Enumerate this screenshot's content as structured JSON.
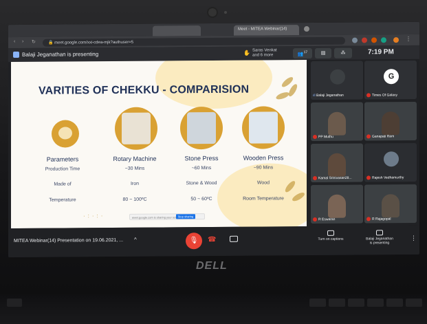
{
  "browser": {
    "tabs": [
      {
        "label": "",
        "active": false
      },
      {
        "label": "Meet - MITEA Webinar(14)",
        "active": true
      }
    ],
    "url": "meet.google.com/xxi-cdea-mjk?authuser=5"
  },
  "meet": {
    "presenting_text": "Balaji Jeganathan is presenting",
    "saras_line1": "Saras Venkat",
    "saras_line2": "and 6 more",
    "participant_count": "17",
    "clock": "7:19 PM"
  },
  "slide": {
    "title": "VARITIES OF CHEKKU - COMPARISION",
    "headers": [
      "Parameters",
      "Rotary Machine",
      "Stone Press",
      "Wooden Press"
    ],
    "rows": [
      {
        "label": "Production Time",
        "values": [
          "~30 Mins",
          "~60 Mins",
          "~90 Mins"
        ]
      },
      {
        "label": "Made of",
        "values": [
          "Iron",
          "Stone & Wood",
          "Wood"
        ]
      },
      {
        "label": "Temperature",
        "values": [
          "80 ~ 100ºC",
          "50 ~ 60ºC",
          "Room Temperature"
        ]
      }
    ],
    "share_bar_text": "meet.google.com is sharing your screen",
    "share_bar_button": "Stop sharing"
  },
  "participants": [
    {
      "name": "Balaji Jeganathan",
      "type": "speaking"
    },
    {
      "name": "Times Of Galaxy",
      "type": "logo",
      "initial": "G"
    },
    {
      "name": "PP Muthu",
      "type": "video"
    },
    {
      "name": "Ganapati Ram",
      "type": "video"
    },
    {
      "name": "Kamal Srinivasan28...",
      "type": "video"
    },
    {
      "name": "Rajesh Vedhamurthy",
      "type": "video"
    },
    {
      "name": "R Eswaran",
      "type": "video"
    },
    {
      "name": "R Rajagopal",
      "type": "video"
    }
  ],
  "bottom": {
    "meeting_title": "MITEA Webinar(14) Presentation on 19.06.2021, ...",
    "captions_label": "Turn on captions",
    "presenting_line1": "Balaji Jeganathan",
    "presenting_line2": "is presenting"
  },
  "laptop": {
    "brand": "DELL"
  },
  "colors": {
    "slide_title": "#1f3057",
    "accent_gold": "#d9a133",
    "meet_bg": "#202124",
    "end_red": "#ea4335"
  }
}
